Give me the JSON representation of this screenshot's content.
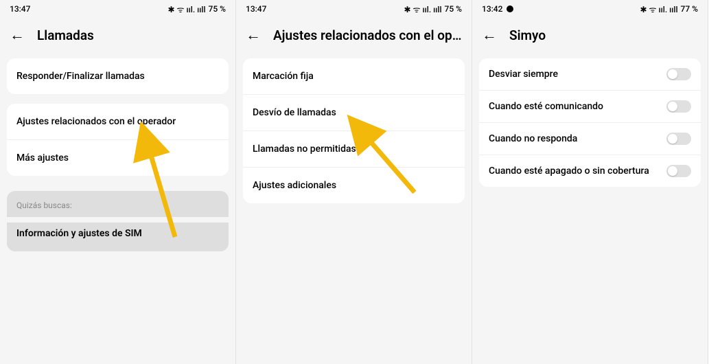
{
  "panels": [
    {
      "statusbar": {
        "time": "13:47",
        "battery": "75 %",
        "icons": "✱ ᯤ ııl. ııll "
      },
      "header": {
        "title": "Llamadas"
      },
      "cards": [
        {
          "rows": [
            "Responder/Finalizar llamadas"
          ]
        },
        {
          "rows": [
            "Ajustes relacionados con el operador",
            "Más ajustes"
          ]
        }
      ],
      "hint": {
        "label": "Quizás buscas:",
        "item": "Información y ajustes de SIM"
      }
    },
    {
      "statusbar": {
        "time": "13:47",
        "battery": "75 %",
        "icons": "✱ ᯤ ııl. ııll "
      },
      "header": {
        "title": "Ajustes relacionados con el operad…"
      },
      "cards": [
        {
          "rows": [
            "Marcación fija",
            "Desvío de llamadas",
            "Llamadas no permitidas",
            "Ajustes adicionales"
          ]
        }
      ]
    },
    {
      "statusbar": {
        "time": "13:42",
        "battery": "77 %",
        "icons": "✱ ᯤ ııl. ııll ",
        "extra_icon": true
      },
      "header": {
        "title": "Simyo"
      },
      "toggles": [
        {
          "label": "Desviar siempre",
          "on": false
        },
        {
          "label": "Cuando esté comunicando",
          "on": false
        },
        {
          "label": "Cuando no responda",
          "on": false
        },
        {
          "label": "Cuando esté apagado o sin cobertura",
          "on": false
        }
      ]
    }
  ]
}
